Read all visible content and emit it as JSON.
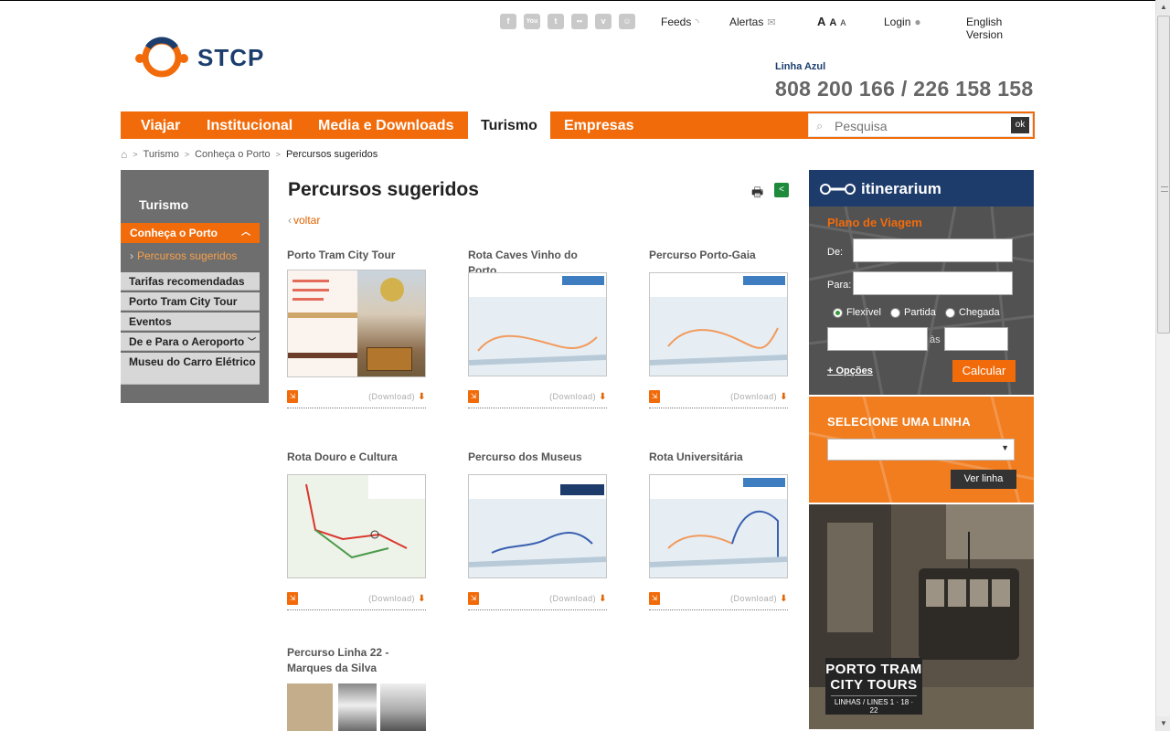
{
  "header": {
    "social": [
      {
        "name": "facebook-icon",
        "glyph": "f"
      },
      {
        "name": "youtube-icon",
        "glyph": "▶"
      },
      {
        "name": "twitter-icon",
        "glyph": "t"
      },
      {
        "name": "flickr-icon",
        "glyph": "••"
      },
      {
        "name": "vimeo-icon",
        "glyph": "v"
      },
      {
        "name": "myspace-icon",
        "glyph": "☺"
      }
    ],
    "feeds": "Feeds",
    "alertas": "Alertas",
    "font_sizes": [
      "A",
      "A",
      "A"
    ],
    "login": "Login",
    "english": "English Version",
    "logo_text": "STCP",
    "hotline_label": "Linha Azul",
    "hotline": "808 200 166 / 226 158 158"
  },
  "nav": {
    "items": [
      "Viajar",
      "Institucional",
      "Media e Downloads",
      "Turismo",
      "Empresas"
    ],
    "active": "Turismo",
    "search_placeholder": "Pesquisa",
    "search_button": "ok"
  },
  "breadcrumb": [
    "Turismo",
    "Conheça o Porto",
    "Percursos sugeridos"
  ],
  "sidebar": {
    "title": "Turismo",
    "section": "Conheça o Porto",
    "sub": "Percursos sugeridos",
    "items": [
      "Tarifas recomendadas",
      "Porto Tram City Tour",
      "Eventos",
      "De e Para o Aeroporto",
      "Museu do Carro Elétrico"
    ]
  },
  "content": {
    "title": "Percursos sugeridos",
    "back": "voltar",
    "download_label": "(Download)",
    "cards": [
      {
        "title": "Porto Tram City Tour"
      },
      {
        "title": "Rota Caves Vinho do Porto"
      },
      {
        "title": "Percurso Porto-Gaia"
      },
      {
        "title": "Rota Douro e Cultura"
      },
      {
        "title": "Percurso dos Museus"
      },
      {
        "title": "Rota Universitária"
      },
      {
        "title": "Percurso Linha 22 - Marques da Silva"
      }
    ]
  },
  "itinerarium": {
    "title": "itinerarium",
    "plan": "Plano de Viagem",
    "from_label": "De:",
    "to_label": "Para:",
    "options": [
      "Flexível",
      "Partida",
      "Chegada"
    ],
    "selected_option": "Flexível",
    "time_sep": "às",
    "more_options": "+ Opções",
    "calc_button": "Calcular"
  },
  "linha": {
    "title": "SELECIONE UMA LINHA",
    "button": "Ver linha"
  },
  "promo": {
    "line1": "PORTO TRAM",
    "line2": "CITY TOURS",
    "line3": "LINHAS / LINES 1 · 18 · 22"
  },
  "colors": {
    "brand_orange": "#f26b0a",
    "brand_blue": "#1d3c6c"
  }
}
